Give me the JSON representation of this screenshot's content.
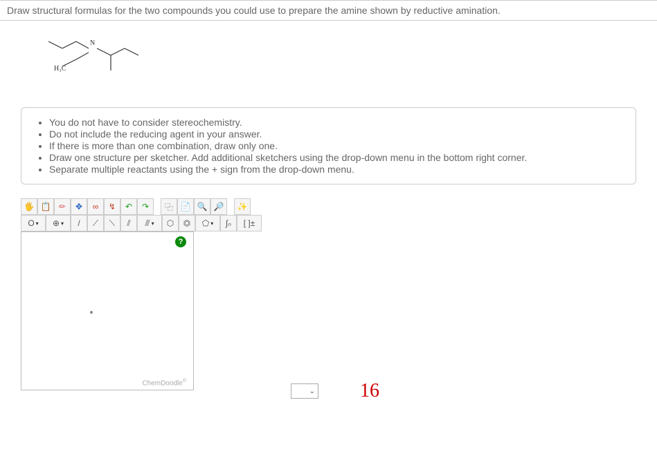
{
  "question": {
    "prompt": "Draw structural formulas for the two compounds you could use to prepare the amine shown by reductive amination."
  },
  "molecule": {
    "label_h3c": "H₃C",
    "label_n": "N"
  },
  "instructions": {
    "items": [
      "You do not have to consider stereochemistry.",
      "Do not include the reducing agent in your answer.",
      "If there is more than one combination, draw only one.",
      "Draw one structure per sketcher. Add additional sketchers using the drop-down menu in the bottom right corner.",
      "Separate multiple reactants using the + sign from the drop-down menu."
    ]
  },
  "toolbar": {
    "row1": {
      "hand": "✋",
      "clipboard": "📋",
      "eraser": "🧹",
      "move": "✥",
      "chain": "∞",
      "template": "↯",
      "undo": "↶",
      "redo": "↷",
      "copy": "⿻",
      "paste": "📄",
      "zoom_in": "🔍+",
      "zoom_out": "🔍-",
      "clean": "✨"
    },
    "row2": {
      "element": "O",
      "charge": "⊕",
      "single": "/",
      "wedge": "⟋",
      "dash": "⟍",
      "double": "⫽",
      "triple": "⫻",
      "hex": "⬡",
      "benz": "⏣",
      "pent": "⬠",
      "cn": "ᴄɴ",
      "bracket": "[ ]±"
    }
  },
  "sketcher": {
    "help": "?",
    "watermark": "ChemDoodle",
    "watermark_sup": "®"
  },
  "dropdown": {
    "caret": "⌄"
  },
  "annotation": {
    "text": "16"
  }
}
